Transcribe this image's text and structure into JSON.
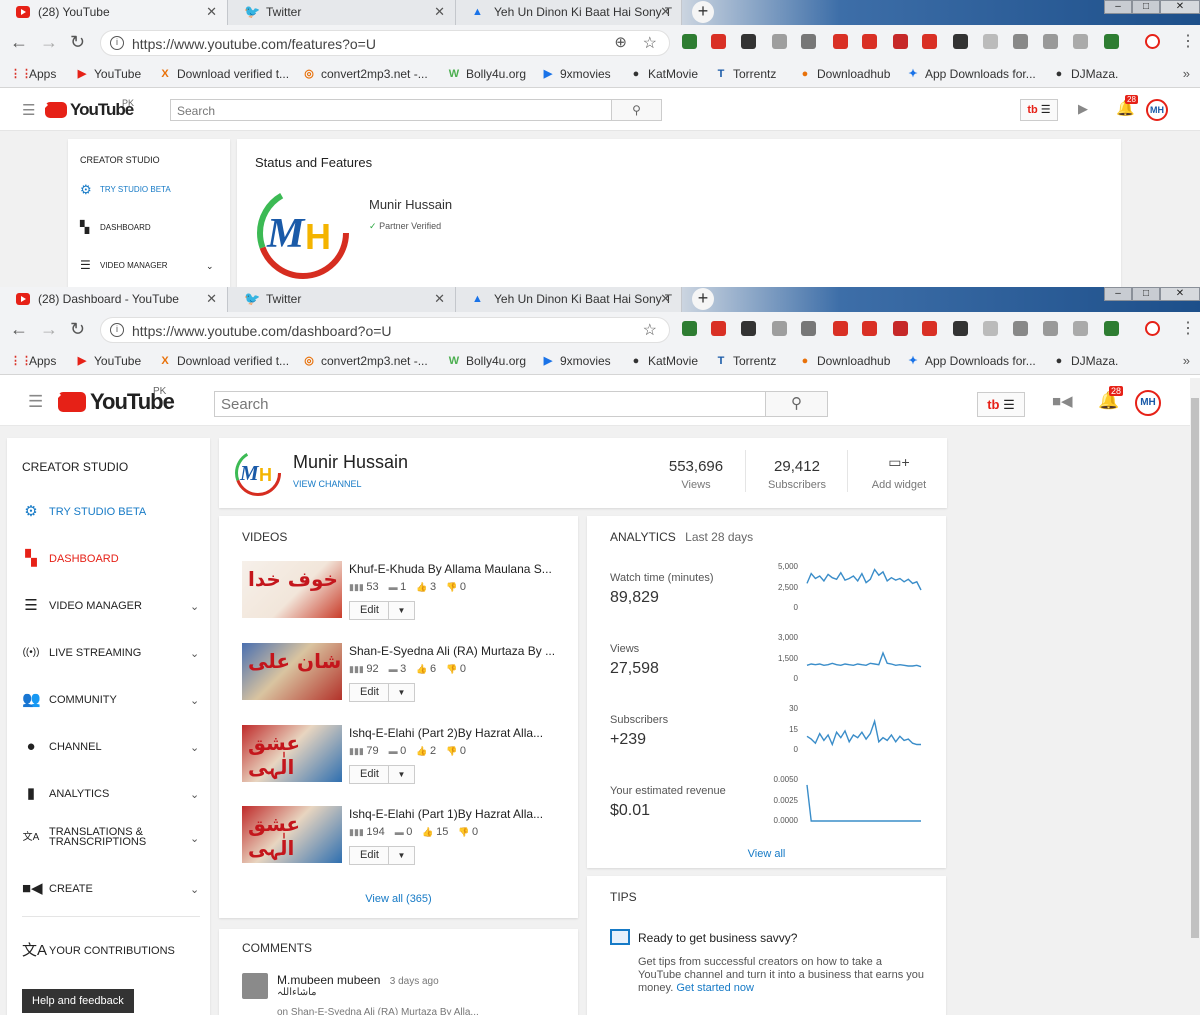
{
  "window1": {
    "tabs": [
      {
        "title": "(28) YouTube",
        "icon": "youtube-icon",
        "active": true
      },
      {
        "title": "Twitter",
        "icon": "twitter-icon",
        "active": false
      },
      {
        "title": "Yeh Un Dinon Ki Baat Hai Sony T",
        "icon": "sony-icon",
        "active": false
      }
    ],
    "url": "https://www.youtube.com/features?o=U",
    "search_placeholder": "Search",
    "notification_count": "28",
    "yt_country": "PK",
    "sidebar": {
      "header": "CREATOR STUDIO",
      "items": [
        {
          "label": "TRY STUDIO BETA",
          "icon": "gear-icon"
        },
        {
          "label": "DASHBOARD",
          "icon": "dashboard-icon"
        },
        {
          "label": "VIDEO MANAGER",
          "icon": "video-manager-icon"
        }
      ]
    },
    "status": {
      "title": "Status and Features",
      "channel_name": "Munir Hussain",
      "verified": "Partner Verified"
    }
  },
  "window2": {
    "tabs": [
      {
        "title": "(28) Dashboard - YouTube",
        "icon": "youtube-icon",
        "active": true
      },
      {
        "title": "Twitter",
        "icon": "twitter-icon",
        "active": false
      },
      {
        "title": "Yeh Un Dinon Ki Baat Hai Sony T",
        "icon": "sony-icon",
        "active": false
      }
    ],
    "url": "https://www.youtube.com/dashboard?o=U",
    "search_placeholder": "Search",
    "notification_count": "28",
    "yt_country": "PK"
  },
  "bookmarks": [
    {
      "label": "Apps",
      "icon": "apps-icon"
    },
    {
      "label": "YouTube",
      "icon": "youtube-icon"
    },
    {
      "label": "Download verified t...",
      "icon": "x-icon"
    },
    {
      "label": "convert2mp3.net -...",
      "icon": "convert-icon"
    },
    {
      "label": "Bolly4u.org",
      "icon": "bolly-icon"
    },
    {
      "label": "9xmovies",
      "icon": "play-icon"
    },
    {
      "label": "KatMovie",
      "icon": "kat-icon"
    },
    {
      "label": "Torrentz",
      "icon": "torrentz-icon"
    },
    {
      "label": "Downloadhub",
      "icon": "downloadhub-icon"
    },
    {
      "label": "App Downloads for...",
      "icon": "app-download-icon"
    },
    {
      "label": "DJMaza.",
      "icon": "djmaza-icon"
    }
  ],
  "dashboard": {
    "sidebar": {
      "header": "CREATOR STUDIO",
      "items": [
        {
          "label": "TRY STUDIO BETA",
          "icon": "gear-icon",
          "chevron": false
        },
        {
          "label": "DASHBOARD",
          "icon": "dashboard-icon",
          "chevron": false
        },
        {
          "label": "VIDEO MANAGER",
          "icon": "video-manager-icon",
          "chevron": true
        },
        {
          "label": "LIVE STREAMING",
          "icon": "live-icon",
          "chevron": true
        },
        {
          "label": "COMMUNITY",
          "icon": "community-icon",
          "chevron": true
        },
        {
          "label": "CHANNEL",
          "icon": "channel-icon",
          "chevron": true
        },
        {
          "label": "ANALYTICS",
          "icon": "analytics-icon",
          "chevron": true
        },
        {
          "label": "TRANSLATIONS & TRANSCRIPTIONS",
          "icon": "translate-icon",
          "chevron": true
        },
        {
          "label": "CREATE",
          "icon": "create-icon",
          "chevron": true
        }
      ],
      "contributions": "YOUR CONTRIBUTIONS",
      "help": "Help and feedback"
    },
    "channel": {
      "name": "Munir Hussain",
      "view_channel": "VIEW CHANNEL",
      "views_value": "553,696",
      "views_label": "Views",
      "subs_value": "29,412",
      "subs_label": "Subscribers",
      "add_widget": "Add widget"
    },
    "videos": {
      "header": "VIDEOS",
      "view_all": "View all (365)",
      "edit_label": "Edit",
      "items": [
        {
          "title": "Khuf-E-Khuda By Allama Maulana S...",
          "views": "53",
          "comments": "1",
          "likes": "3",
          "dislikes": "0",
          "thumb_text": "خوف خدا"
        },
        {
          "title": "Shan-E-Syedna Ali (RA) Murtaza By ...",
          "views": "92",
          "comments": "3",
          "likes": "6",
          "dislikes": "0",
          "thumb_text": "شان علی"
        },
        {
          "title": "Ishq-E-Elahi (Part 2)By Hazrat Alla...",
          "views": "79",
          "comments": "0",
          "likes": "2",
          "dislikes": "0",
          "thumb_text": "عشق الٰہی"
        },
        {
          "title": "Ishq-E-Elahi (Part 1)By Hazrat Alla...",
          "views": "194",
          "comments": "0",
          "likes": "15",
          "dislikes": "0",
          "thumb_text": "عشق الٰہی"
        }
      ]
    },
    "analytics": {
      "header": "ANALYTICS",
      "period": "Last 28 days",
      "view_all": "View all",
      "metrics": [
        {
          "label": "Watch time (minutes)",
          "value": "89,829",
          "ticks": [
            "5,000",
            "2,500",
            "0"
          ]
        },
        {
          "label": "Views",
          "value": "27,598",
          "ticks": [
            "3,000",
            "1,500",
            "0"
          ]
        },
        {
          "label": "Subscribers",
          "value": "+239",
          "ticks": [
            "30",
            "15",
            "0"
          ]
        },
        {
          "label": "Your estimated revenue",
          "value": "$0.01",
          "ticks": [
            "0.0050",
            "0.0025",
            "0.0000"
          ]
        }
      ]
    },
    "comments": {
      "header": "COMMENTS",
      "author": "M.mubeen mubeen",
      "time": "3 days ago",
      "text": "ماشاءاللہ",
      "on": "on Shan-E-Syedna Ali (RA) Murtaza By Alla..."
    },
    "tips": {
      "header": "TIPS",
      "title": "Ready to get business savvy?",
      "body": "Get tips from successful creators on how to take a YouTube channel and turn it into a business that earns you money.",
      "link": "Get started now"
    }
  },
  "chart_data": [
    {
      "type": "line",
      "title": "Watch time (minutes)",
      "ylim": [
        0,
        5000
      ],
      "x": [
        1,
        2,
        3,
        4,
        5,
        6,
        7,
        8,
        9,
        10,
        11,
        12,
        13,
        14,
        15,
        16,
        17,
        18,
        19,
        20,
        21,
        22,
        23,
        24,
        25,
        26,
        27,
        28
      ],
      "values": [
        3000,
        4200,
        3600,
        3900,
        3300,
        4100,
        3700,
        3500,
        4300,
        3400,
        3600,
        3900,
        3300,
        4200,
        3100,
        3500,
        4700,
        4000,
        4400,
        3300,
        3700,
        3400,
        3600,
        3200,
        3500,
        3000,
        3200,
        2200
      ]
    },
    {
      "type": "line",
      "title": "Views",
      "ylim": [
        0,
        3000
      ],
      "x": [
        1,
        2,
        3,
        4,
        5,
        6,
        7,
        8,
        9,
        10,
        11,
        12,
        13,
        14,
        15,
        16,
        17,
        18,
        19,
        20,
        21,
        22,
        23,
        24,
        25,
        26,
        27,
        28
      ],
      "values": [
        1000,
        1100,
        1050,
        1100,
        1000,
        1050,
        1150,
        1050,
        1000,
        1100,
        1050,
        1000,
        1100,
        1050,
        1000,
        1150,
        1100,
        1050,
        1900,
        1150,
        1100,
        1000,
        1050,
        1000,
        950,
        950,
        1000,
        900
      ]
    },
    {
      "type": "line",
      "title": "Subscribers",
      "ylim": [
        0,
        30
      ],
      "x": [
        1,
        2,
        3,
        4,
        5,
        6,
        7,
        8,
        9,
        10,
        11,
        12,
        13,
        14,
        15,
        16,
        17,
        18,
        19,
        20,
        21,
        22,
        23,
        24,
        25,
        26,
        27,
        28
      ],
      "values": [
        10,
        8,
        5,
        12,
        7,
        11,
        4,
        13,
        9,
        14,
        6,
        11,
        9,
        13,
        8,
        12,
        21,
        6,
        9,
        7,
        11,
        6,
        10,
        7,
        8,
        5,
        4,
        4
      ]
    },
    {
      "type": "line",
      "title": "Your estimated revenue",
      "ylim": [
        0,
        0.005
      ],
      "x": [
        1,
        2,
        3,
        4,
        5,
        6,
        7,
        8,
        9,
        10,
        11,
        12,
        13,
        14,
        15,
        16,
        17,
        18,
        19,
        20,
        21,
        22,
        23,
        24,
        25,
        26,
        27,
        28
      ],
      "values": [
        0.0044,
        0,
        0,
        0,
        0,
        0,
        0,
        0,
        0,
        0,
        0,
        0,
        0,
        0,
        0,
        0,
        0,
        0,
        0,
        0,
        0,
        0,
        0,
        0,
        0,
        0,
        0,
        0
      ]
    }
  ],
  "colors": {
    "youtube_red": "#e62117",
    "link_blue": "#167ac6",
    "chart_line": "#3a8dc9"
  }
}
